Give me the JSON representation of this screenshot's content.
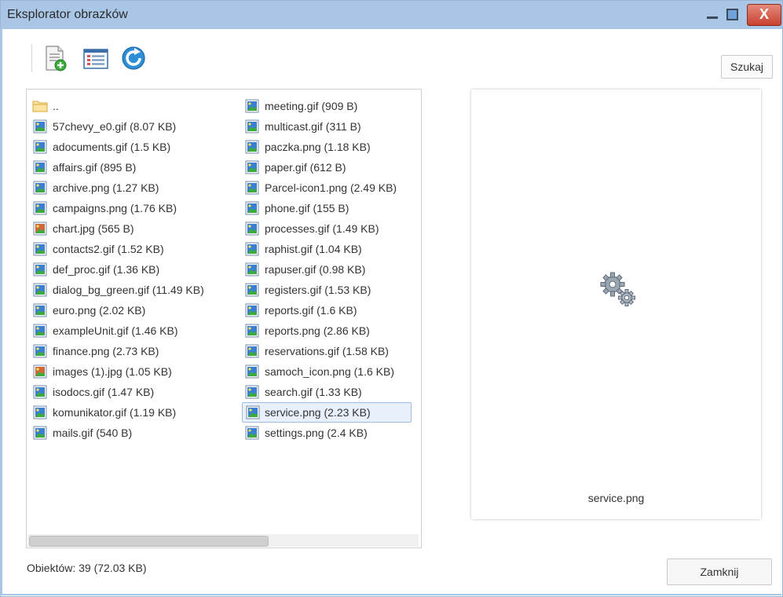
{
  "window": {
    "title": "Eksplorator obrazków",
    "close_glyph": "X"
  },
  "toolbar": {
    "icons": [
      "new-file-icon",
      "list-view-icon",
      "refresh-icon"
    ],
    "search_label": "Szukaj"
  },
  "files": {
    "column1": [
      {
        "label": "..",
        "type": "folder"
      },
      {
        "label": "57chevy_e0.gif (8.07 KB)",
        "type": "image"
      },
      {
        "label": "adocuments.gif (1.5 KB)",
        "type": "image"
      },
      {
        "label": "affairs.gif (895 B)",
        "type": "image"
      },
      {
        "label": "archive.png (1.27 KB)",
        "type": "image"
      },
      {
        "label": "campaigns.png (1.76 KB)",
        "type": "image"
      },
      {
        "label": "chart.jpg (565 B)",
        "type": "photo"
      },
      {
        "label": "contacts2.gif (1.52 KB)",
        "type": "image"
      },
      {
        "label": "def_proc.gif (1.36 KB)",
        "type": "image"
      },
      {
        "label": "dialog_bg_green.gif (11.49 KB)",
        "type": "image"
      },
      {
        "label": "euro.png (2.02 KB)",
        "type": "image"
      },
      {
        "label": "exampleUnit.gif (1.46 KB)",
        "type": "image"
      },
      {
        "label": "finance.png (2.73 KB)",
        "type": "image"
      },
      {
        "label": "images (1).jpg (1.05 KB)",
        "type": "photo"
      },
      {
        "label": "isodocs.gif (1.47 KB)",
        "type": "image"
      },
      {
        "label": "komunikator.gif (1.19 KB)",
        "type": "image"
      },
      {
        "label": "mails.gif (540 B)",
        "type": "image"
      }
    ],
    "column2": [
      {
        "label": "meeting.gif (909 B)",
        "type": "image"
      },
      {
        "label": "multicast.gif (311 B)",
        "type": "image"
      },
      {
        "label": "paczka.png (1.18 KB)",
        "type": "image"
      },
      {
        "label": "paper.gif (612 B)",
        "type": "image"
      },
      {
        "label": "Parcel-icon1.png (2.49 KB)",
        "type": "image"
      },
      {
        "label": "phone.gif (155 B)",
        "type": "image"
      },
      {
        "label": "processes.gif (1.49 KB)",
        "type": "image"
      },
      {
        "label": "raphist.gif (1.04 KB)",
        "type": "image"
      },
      {
        "label": "rapuser.gif (0.98 KB)",
        "type": "image"
      },
      {
        "label": "registers.gif (1.53 KB)",
        "type": "image"
      },
      {
        "label": "reports.gif (1.6 KB)",
        "type": "image"
      },
      {
        "label": "reports.png (2.86 KB)",
        "type": "image"
      },
      {
        "label": "reservations.gif (1.58 KB)",
        "type": "image"
      },
      {
        "label": "samoch_icon.png (1.6 KB)",
        "type": "image"
      },
      {
        "label": "search.gif (1.33 KB)",
        "type": "image"
      },
      {
        "label": "service.png (2.23 KB)",
        "type": "image",
        "selected": true
      },
      {
        "label": "settings.png (2.4 KB)",
        "type": "image"
      }
    ]
  },
  "preview": {
    "filename": "service.png",
    "icon": "gears-icon"
  },
  "status": {
    "text": "Obiektów: 39 (72.03 KB)"
  },
  "footer": {
    "close_label": "Zamknij"
  },
  "colors": {
    "titlebar": "#a9c6e6",
    "close_button": "#c9412e",
    "selection": "#e8f0fb"
  }
}
